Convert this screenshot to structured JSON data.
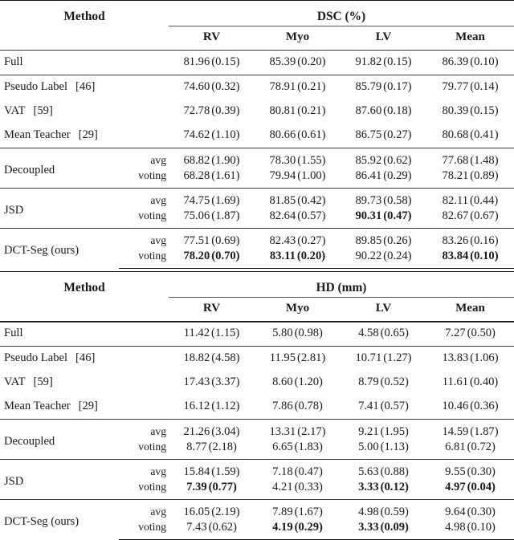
{
  "tables": [
    {
      "id": "dsc",
      "method_header": "Method",
      "group_header": "DSC (%)",
      "sub_headers": [
        "RV",
        "Myo",
        "LV",
        "Mean"
      ],
      "sections": [
        {
          "rows": [
            {
              "method": "Full",
              "cite": "",
              "mode": "",
              "values": [
                "81.96 (0.15)",
                "85.39 (0.20)",
                "91.82 (0.15)",
                "86.39 (0.10)"
              ],
              "bold": [
                false,
                false,
                false,
                false
              ]
            }
          ]
        },
        {
          "rows": [
            {
              "method": "Pseudo Label",
              "cite": "[46]",
              "mode": "",
              "values": [
                "74.60 (0.32)",
                "78.91 (0.21)",
                "85.79 (0.17)",
                "79.77 (0.14)"
              ],
              "bold": [
                false,
                false,
                false,
                false
              ]
            },
            {
              "method": "VAT",
              "cite": "[59]",
              "mode": "",
              "values": [
                "72.78 (0.39)",
                "80.81 (0.21)",
                "87.60 (0.18)",
                "80.39 (0.15)"
              ],
              "bold": [
                false,
                false,
                false,
                false
              ]
            },
            {
              "method": "Mean Teacher",
              "cite": "[29]",
              "mode": "",
              "values": [
                "74.62 (1.10)",
                "80.66 (0.61)",
                "86.75 (0.27)",
                "80.68 (0.41)"
              ],
              "bold": [
                false,
                false,
                false,
                false
              ]
            }
          ]
        },
        {
          "method": "Decoupled",
          "rows": [
            {
              "mode": "avg",
              "values": [
                "68.82 (1.90)",
                "78.30 (1.55)",
                "85.92 (0.62)",
                "77.68 (1.48)"
              ],
              "bold": [
                false,
                false,
                false,
                false
              ]
            },
            {
              "mode": "voting",
              "values": [
                "68.28 (1.61)",
                "79.94 (1.00)",
                "86.41 (0.29)",
                "78.21 (0.89)"
              ],
              "bold": [
                false,
                false,
                false,
                false
              ]
            }
          ]
        },
        {
          "method": "JSD",
          "rows": [
            {
              "mode": "avg",
              "values": [
                "74.75 (1.69)",
                "81.85 (0.42)",
                "89.73 (0.58)",
                "82.11 (0.44)"
              ],
              "bold": [
                false,
                false,
                false,
                false
              ]
            },
            {
              "mode": "voting",
              "values": [
                "75.06 (1.87)",
                "82.64 (0.57)",
                "90.31 (0.47)",
                "82.67 (0.67)"
              ],
              "bold": [
                false,
                false,
                true,
                false
              ]
            }
          ]
        },
        {
          "method": "DCT-Seg (ours)",
          "rows": [
            {
              "mode": "avg",
              "values": [
                "77.51 (0.69)",
                "82.43 (0.27)",
                "89.85 (0.26)",
                "83.26 (0.16)"
              ],
              "bold": [
                false,
                false,
                false,
                false
              ]
            },
            {
              "mode": "voting",
              "values": [
                "78.20 (0.70)",
                "83.11 (0.20)",
                "90.22 (0.24)",
                "83.84 (0.10)"
              ],
              "bold": [
                true,
                true,
                false,
                true
              ]
            }
          ]
        }
      ]
    },
    {
      "id": "hd",
      "method_header": "Method",
      "group_header": "HD (mm)",
      "sub_headers": [
        "RV",
        "Myo",
        "LV",
        "Mean"
      ],
      "sections": [
        {
          "rows": [
            {
              "method": "Full",
              "cite": "",
              "mode": "",
              "values": [
                "11.42 (1.15)",
                "5.80 (0.98)",
                "4.58 (0.65)",
                "7.27 (0.50)"
              ],
              "bold": [
                false,
                false,
                false,
                false
              ]
            }
          ]
        },
        {
          "rows": [
            {
              "method": "Pseudo Label",
              "cite": "[46]",
              "mode": "",
              "values": [
                "18.82 (4.58)",
                "11.95 (2.81)",
                "10.71 (1.27)",
                "13.83 (1.06)"
              ],
              "bold": [
                false,
                false,
                false,
                false
              ]
            },
            {
              "method": "VAT",
              "cite": "[59]",
              "mode": "",
              "values": [
                "17.43 (3.37)",
                "8.60 (1.20)",
                "8.79 (0.52)",
                "11.61 (0.40)"
              ],
              "bold": [
                false,
                false,
                false,
                false
              ]
            },
            {
              "method": "Mean Teacher",
              "cite": "[29]",
              "mode": "",
              "values": [
                "16.12 (1.12)",
                "7.86 (0.78)",
                "7.41 (0.57)",
                "10.46 (0.36)"
              ],
              "bold": [
                false,
                false,
                false,
                false
              ]
            }
          ]
        },
        {
          "method": "Decoupled",
          "rows": [
            {
              "mode": "avg",
              "values": [
                "21.26 (3.04)",
                "13.31 (2.17)",
                "9.21 (1.95)",
                "14.59 (1.87)"
              ],
              "bold": [
                false,
                false,
                false,
                false
              ]
            },
            {
              "mode": "voting",
              "values": [
                "8.77 (2.18)",
                "6.65 (1.83)",
                "5.00 (1.13)",
                "6.81 (0.72)"
              ],
              "bold": [
                false,
                false,
                false,
                false
              ]
            }
          ]
        },
        {
          "method": "JSD",
          "rows": [
            {
              "mode": "avg",
              "values": [
                "15.84 (1.59)",
                "7.18 (0.47)",
                "5.63 (0.88)",
                "9.55 (0.30)"
              ],
              "bold": [
                false,
                false,
                false,
                false
              ]
            },
            {
              "mode": "voting",
              "values": [
                "7.39 (0.77)",
                "4.21 (0.33)",
                "3.33 (0.12)",
                "4.97 (0.04)"
              ],
              "bold": [
                true,
                false,
                true,
                true
              ]
            }
          ]
        },
        {
          "method": "DCT-Seg (ours)",
          "rows": [
            {
              "mode": "avg",
              "values": [
                "16.05 (2.19)",
                "7.89 (1.67)",
                "4.98 (0.59)",
                "9.64 (0.30)"
              ],
              "bold": [
                false,
                false,
                false,
                false
              ]
            },
            {
              "mode": "voting",
              "values": [
                "7.43 (0.62)",
                "4.19 (0.29)",
                "3.33 (0.09)",
                "4.98 (0.10)"
              ],
              "bold": [
                false,
                true,
                true,
                false
              ]
            }
          ]
        }
      ]
    }
  ]
}
